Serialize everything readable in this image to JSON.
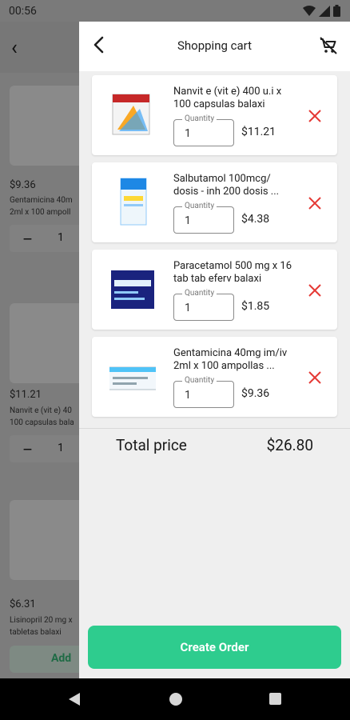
{
  "status_bar": {
    "time": "00:56"
  },
  "background_list": {
    "products": [
      {
        "price": "$9.36",
        "name_lines": [
          "Gentamicina 40m",
          "2ml x 100 ampoll"
        ],
        "quantity": "1"
      },
      {
        "price": "$11.21",
        "name_lines": [
          "Nanvit e (vit e) 40",
          "100 capsulas bala"
        ],
        "quantity": "1"
      },
      {
        "price": "$6.31",
        "name_lines": [
          "Lisinopril 20 mg x",
          "tabletas balaxi"
        ],
        "add_label": "Add"
      }
    ]
  },
  "cart": {
    "title": "Shopping cart",
    "quantity_label": "Quantity",
    "items": [
      {
        "name": "Nanvit e (vit e) 400 u.i x 100 capsulas balaxi",
        "quantity": "1",
        "price": "$11.21"
      },
      {
        "name": "Salbutamol 100mcg/ dosis - inh 200 dosis ...",
        "quantity": "1",
        "price": "$4.38"
      },
      {
        "name": "Paracetamol 500 mg x 16 tab tab eferv balaxi",
        "quantity": "1",
        "price": "$1.85"
      },
      {
        "name": "Gentamicina 40mg im/iv 2ml x 100 ampollas ...",
        "quantity": "1",
        "price": "$9.36"
      }
    ],
    "total_label": "Total price",
    "total_value": "$26.80",
    "create_order_label": "Create Order"
  },
  "colors": {
    "accent": "#2ecc8e",
    "remove": "#e53935"
  },
  "icons": [
    "back-arrow-icon",
    "remove-cart-icon",
    "close-icon",
    "wifi-icon",
    "signal-icon",
    "battery-icon"
  ]
}
